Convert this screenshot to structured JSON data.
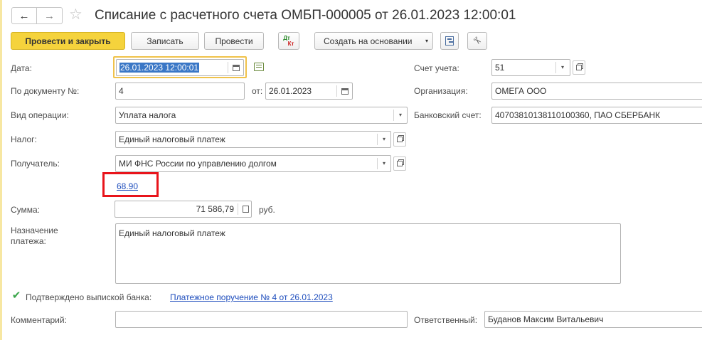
{
  "window": {
    "title": "Списание с расчетного счета ОМБП-000005 от 26.01.2023 12:00:01"
  },
  "nav": {
    "back_icon": "arrow-left-icon",
    "forward_icon": "arrow-right-icon",
    "favorite_icon": "star-icon"
  },
  "toolbar": {
    "post_close": "Провести и закрыть",
    "save": "Записать",
    "post": "Провести",
    "dt_kt_top": "Дт",
    "dt_kt_bottom": "Кт",
    "create_based": "Создать на основании"
  },
  "form": {
    "date_label": "Дата:",
    "date_value": "26.01.2023 12:00:01",
    "doc_num_label": "По документу №:",
    "doc_num_value": "4",
    "from_label": "от:",
    "from_value": "26.01.2023",
    "op_type_label": "Вид операции:",
    "op_type_value": "Уплата налога",
    "tax_label": "Налог:",
    "tax_value": "Единый налоговый платеж",
    "recipient_label": "Получатель:",
    "recipient_value": "МИ ФНС России по управлению долгом",
    "code_link": "68.90",
    "sum_label": "Сумма:",
    "sum_value": "71 586,79",
    "currency": "руб.",
    "purpose_label_1": "Назначение",
    "purpose_label_2": "платежа:",
    "purpose_value": "Единый налоговый платеж",
    "confirmed_label": "Подтверждено выпиской банка:",
    "confirmed_checked": true,
    "payment_order_link": "Платежное поручение № 4 от 26.01.2023",
    "comment_label": "Комментарий:",
    "comment_value": "",
    "account_label": "Счет учета:",
    "account_value": "51",
    "org_label": "Организация:",
    "org_value": "ОМЕГА ООО",
    "bank_label": "Банковский счет:",
    "bank_value": "40703810138110100360, ПАО СБЕРБАНК",
    "responsible_label": "Ответственный:",
    "responsible_value": "Буданов Максим Витальевич"
  },
  "colors": {
    "primary_button": "#f5d33c",
    "highlight_box": "#e8141b",
    "focus_border": "#f0c24a",
    "selection": "#3a77c6",
    "link": "#1f4ebd",
    "check": "#3aa64a"
  }
}
